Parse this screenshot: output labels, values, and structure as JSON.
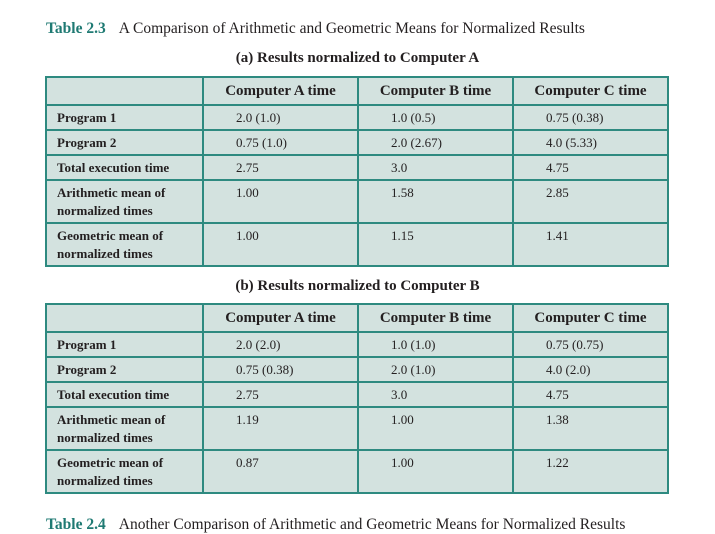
{
  "caption": {
    "number": "Table 2.3",
    "title": "A Comparison of Arithmetic and Geometric Means for Normalized Results"
  },
  "next_caption": {
    "number": "Table 2.4",
    "title": "Another Comparison of Arithmetic and Geometric Means for Normalized Results"
  },
  "tables": [
    {
      "subtitle": "(a) Results normalized to Computer A",
      "headers": [
        "",
        "Computer A time",
        "Computer B time",
        "Computer C time"
      ],
      "rows": [
        {
          "label": "Program 1",
          "values": [
            "2.0 (1.0)",
            "1.0 (0.5)",
            "0.75 (0.38)"
          ]
        },
        {
          "label": "Program 2",
          "values": [
            "0.75 (1.0)",
            "2.0 (2.67)",
            "4.0 (5.33)"
          ]
        },
        {
          "label": "Total execution time",
          "values": [
            "2.75",
            "3.0",
            "4.75"
          ]
        },
        {
          "label": "Arithmetic mean of normalized times",
          "values": [
            "1.00",
            "1.58",
            "2.85"
          ]
        },
        {
          "label": "Geometric mean of normalized times",
          "values": [
            "1.00",
            "1.15",
            "1.41"
          ]
        }
      ]
    },
    {
      "subtitle": "(b) Results normalized to Computer B",
      "headers": [
        "",
        "Computer A time",
        "Computer B time",
        "Computer C time"
      ],
      "rows": [
        {
          "label": "Program 1",
          "values": [
            "2.0 (2.0)",
            "1.0 (1.0)",
            "0.75 (0.75)"
          ]
        },
        {
          "label": "Program 2",
          "values": [
            "0.75 (0.38)",
            "2.0 (1.0)",
            "4.0 (2.0)"
          ]
        },
        {
          "label": "Total execution time",
          "values": [
            "2.75",
            "3.0",
            "4.75"
          ]
        },
        {
          "label": "Arithmetic mean of normalized times",
          "values": [
            "1.19",
            "1.00",
            "1.38"
          ]
        },
        {
          "label": "Geometric mean of normalized times",
          "values": [
            "0.87",
            "1.00",
            "1.22"
          ]
        }
      ]
    }
  ],
  "colors": {
    "accent": "#1f7a73",
    "border": "#2e8a80",
    "cell_bg": "#d3e2df"
  }
}
